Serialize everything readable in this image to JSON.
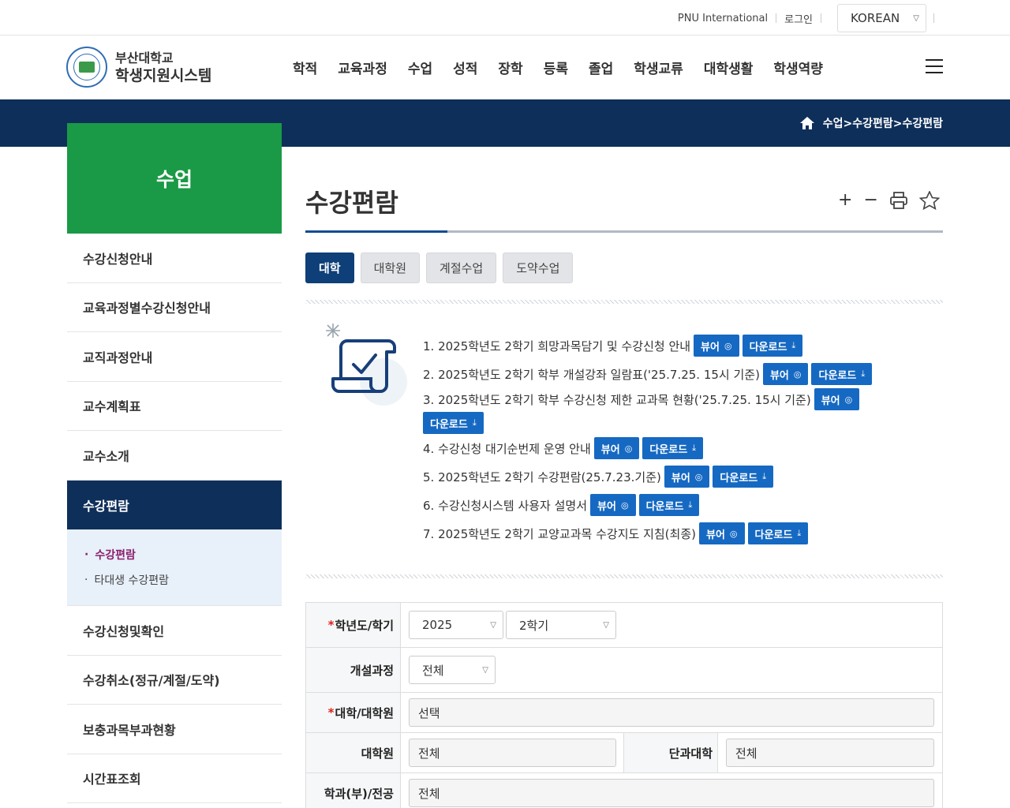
{
  "topbar": {
    "intl_link": "PNU International",
    "login_link": "로그인",
    "language": "KOREAN"
  },
  "header": {
    "logo_line1": "부산대학교",
    "logo_line2": "학생지원시스템",
    "nav": [
      "학적",
      "교육과정",
      "수업",
      "성적",
      "장학",
      "등록",
      "졸업",
      "학생교류",
      "대학생활",
      "학생역량"
    ]
  },
  "breadcrumb": "수업>수강편람>수강편람",
  "sidebar": {
    "title": "수업",
    "items": [
      "수강신청안내",
      "교육과정별수강신청안내",
      "교직과정안내",
      "교수계획표",
      "교수소개",
      "수강편람"
    ],
    "sub_items": [
      "수강편람",
      "타대생 수강편람"
    ],
    "items_after": [
      "수강신청및확인",
      "수강취소(정규/계절/도약)",
      "보충과목부과현황",
      "시간표조회"
    ]
  },
  "page": {
    "title": "수강편람",
    "tools": {
      "zoom_in": "+",
      "zoom_out": "−"
    }
  },
  "tabs": [
    "대학",
    "대학원",
    "계절수업",
    "도약수업"
  ],
  "buttons": {
    "view": "뷰어",
    "download": "다운로드"
  },
  "notices": [
    "1. 2025학년도 2학기 희망과목담기 및 수강신청 안내",
    "2. 2025학년도 2학기 학부 개설강좌 일람표('25.7.25. 15시 기준)",
    "3. 2025학년도 2학기 학부 수강신청 제한 교과목 현황('25.7.25. 15시 기준)",
    "4. 수강신청 대기순번제 운영 안내",
    "5. 2025학년도 2학기 수강편람(25.7.23.기준)",
    "6. 수강신청시스템 사용자 설명서",
    "7. 2025학년도 2학기 교양교과목 수강지도 지침(최종)"
  ],
  "form": {
    "year_label": "학년도/학기",
    "year_value": "2025",
    "term_value": "2학기",
    "course_label": "개설과정",
    "course_value": "전체",
    "college_label": "대학/대학원",
    "college_value": "선택",
    "grad_label": "대학원",
    "grad_value": "전체",
    "dept_college_label": "단과대학",
    "dept_college_value": "전체",
    "major_label": "학과(부)/전공",
    "major_value": "전체",
    "required_mark": "*"
  },
  "colors": {
    "navy": "#0e2f5a",
    "green": "#1a9a46",
    "button_blue": "#1669c2",
    "required": "#e0201b"
  }
}
